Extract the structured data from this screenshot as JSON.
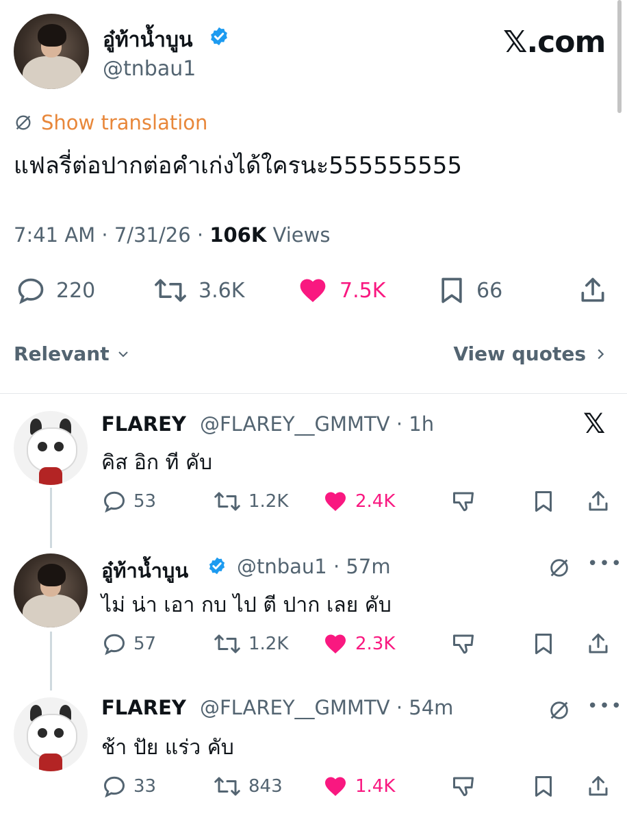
{
  "brand": {
    "label": "𝕏.com"
  },
  "main_tweet": {
    "display_name": "อู๋ท้าน้ำบูน",
    "handle": "@tnbau1",
    "show_translation": "Show translation",
    "text": "แฟลรี่ต่อปากต่อคำเก่งได้ใครนะ555555555",
    "time": "7:41 AM",
    "date": "7/31/26",
    "views_count": "106K",
    "views_label": "Views",
    "stats": {
      "replies": "220",
      "reposts": "3.6K",
      "likes": "7.5K",
      "bookmarks": "66"
    }
  },
  "sort": {
    "label": "Relevant",
    "view_quotes": "View quotes"
  },
  "replies": [
    {
      "display_name": "FLAREY",
      "handle": "@FLAREY__GMMTV",
      "time": "1h",
      "text": "คิส อิก ที คับ",
      "stats": {
        "replies": "53",
        "reposts": "1.2K",
        "likes": "2.4K"
      }
    },
    {
      "display_name": "อู๋ท้าน้ำบูน",
      "handle": "@tnbau1",
      "time": "57m",
      "text": "ไม่ น่า เอา กบ ไป ตี ปาก เลย คับ",
      "stats": {
        "replies": "57",
        "reposts": "1.2K",
        "likes": "2.3K"
      }
    },
    {
      "display_name": "FLAREY",
      "handle": "@FLAREY__GMMTV",
      "time": "54m",
      "text": "ช้า ปัย แร่ว คับ",
      "stats": {
        "replies": "33",
        "reposts": "843",
        "likes": "1.4K"
      }
    }
  ],
  "colors": {
    "like": "#f91880",
    "verified": "#1d9bf0",
    "translate": "#e8873a",
    "muted": "#536471"
  }
}
